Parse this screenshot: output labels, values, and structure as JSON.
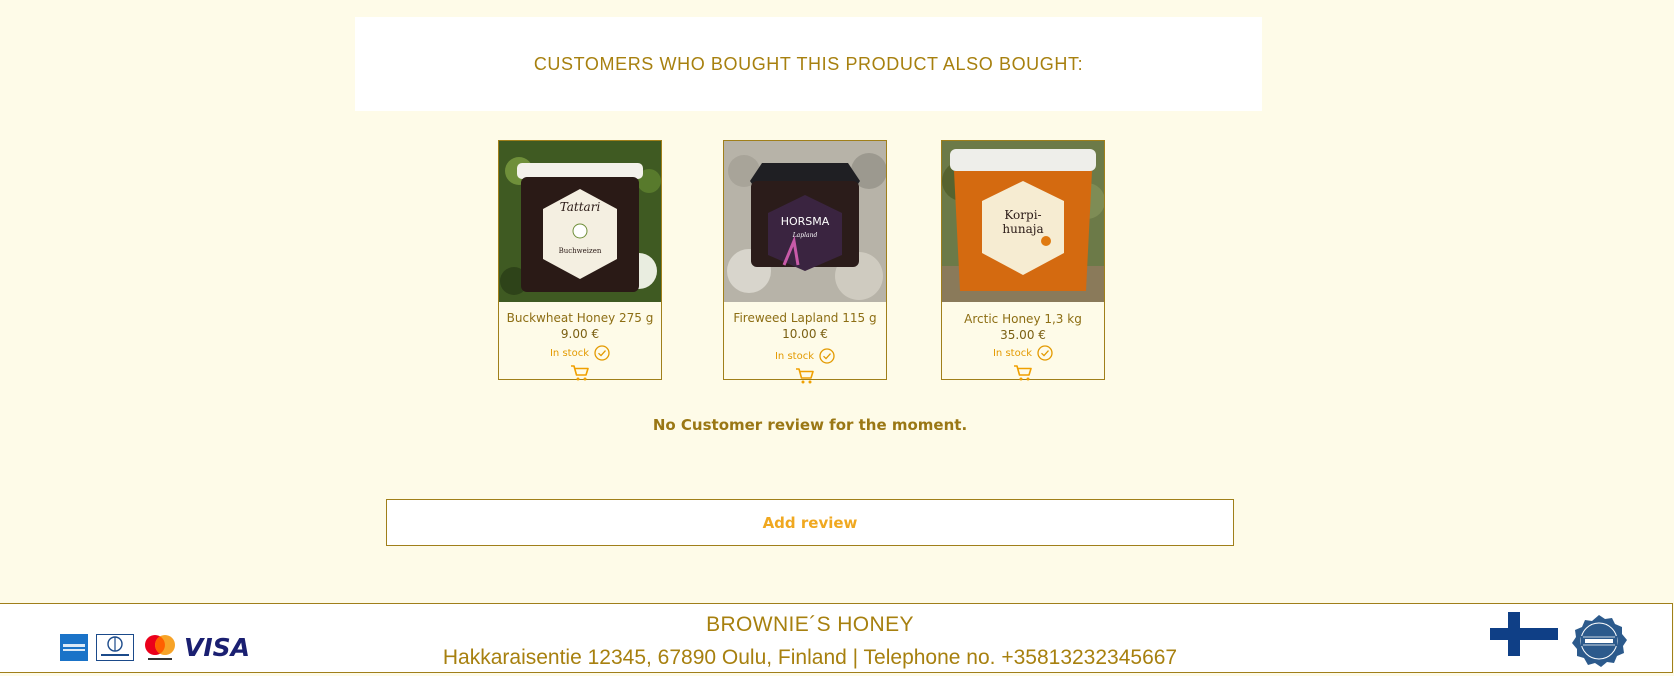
{
  "section": {
    "title": "CUSTOMERS WHO BOUGHT THIS PRODUCT ALSO BOUGHT:"
  },
  "products": [
    {
      "name": "Buckwheat Honey 275 g",
      "price": "9.00 €",
      "stock": "In stock"
    },
    {
      "name": "Fireweed Lapland 115 g",
      "price": "10.00 €",
      "stock": "In stock"
    },
    {
      "name": "Arctic Honey 1,3 kg",
      "price": "35.00 €",
      "stock": "In stock"
    }
  ],
  "reviews": {
    "empty_text": "No Customer review for the moment.",
    "add_label": "Add review"
  },
  "footer": {
    "brand": "BROWNIE´S HONEY",
    "address": "Hakkaraisentie 12345, 67890 Oulu, Finland | Telephone no. +35813232345667",
    "payment_icons": [
      "american-express-icon",
      "diners-club-icon",
      "mastercard-icon",
      "visa-icon"
    ],
    "visa_label": "VISA",
    "badges": [
      "finland-flag-icon",
      "made-in-finland-badge"
    ]
  },
  "colors": {
    "background": "#fefbe8",
    "accent": "#a7800f",
    "stock": "#e39a00",
    "button_text": "#f0a820"
  }
}
